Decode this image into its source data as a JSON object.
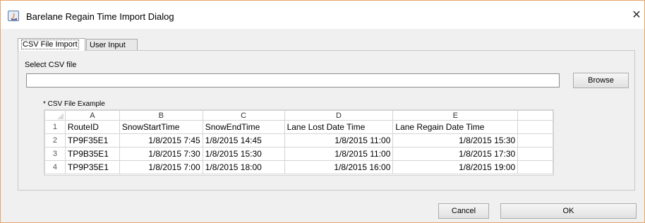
{
  "window": {
    "title": "Barelane Regain Time Import Dialog",
    "close_glyph": "✕"
  },
  "tabs": [
    {
      "label": "CSV File Import",
      "active": true
    },
    {
      "label": "User Input",
      "active": false
    }
  ],
  "csv_import": {
    "select_label": "Select CSV file",
    "file_value": "",
    "browse_label": "Browse",
    "example_label": "* CSV File Example"
  },
  "spreadsheet": {
    "column_letters": [
      "A",
      "B",
      "C",
      "D",
      "E"
    ],
    "headers": [
      "RouteID",
      "SnowStartTime",
      "SnowEndTime",
      "Lane Lost Date Time",
      "Lane Regain Date Time"
    ],
    "rows": [
      {
        "num": "2",
        "cells": [
          "TP9F35E1",
          "1/8/2015 7:45",
          "1/8/2015 14:45",
          "1/8/2015 11:00",
          "1/8/2015 15:30"
        ]
      },
      {
        "num": "3",
        "cells": [
          "TP9B35E1",
          "1/8/2015 7:30",
          "1/8/2015 15:30",
          "1/8/2015 11:00",
          "1/8/2015 17:30"
        ]
      },
      {
        "num": "4",
        "cells": [
          "TP9P35E1",
          "1/8/2015 7:00",
          "1/8/2015 18:00",
          "1/8/2015 16:00",
          "1/8/2015 19:00"
        ]
      }
    ],
    "header_row_num": "1"
  },
  "buttons": {
    "cancel": "Cancel",
    "ok": "OK"
  },
  "colors": {
    "window_border": "#e8a566",
    "grid_line": "#d4d4d4"
  }
}
